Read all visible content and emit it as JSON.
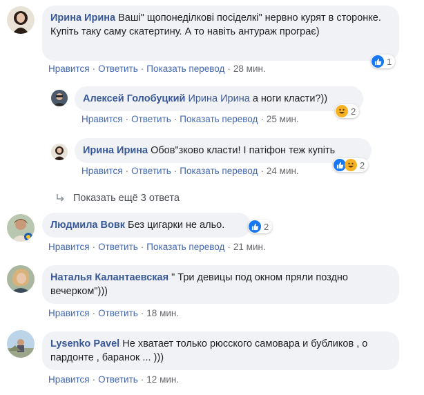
{
  "comments": [
    {
      "author": "Ирина Ирина",
      "text": "Ваші\" щопонеділкові посіделкі\" нервно курят в сторонке. Купіть таку саму скатертину. А то навіть антураж програє)",
      "actions": {
        "like": "Нравится",
        "reply": "Ответить",
        "translate": "Показать перевод",
        "time": "28 мин."
      },
      "reactions": {
        "count": "1",
        "icons": [
          "like-icon"
        ]
      }
    },
    {
      "author": "Алексей Голобуцкий",
      "mention": "Ирина Ирина",
      "text": "а ноги класти?))",
      "actions": {
        "like": "Нравится",
        "reply": "Ответить",
        "translate": "Показать перевод",
        "time": "25 мин."
      },
      "reactions": {
        "count": "2",
        "icons": [
          "haha-icon"
        ]
      }
    },
    {
      "author": "Ирина Ирина",
      "text": "Обов\"зково класти! І патіфон теж купіть",
      "actions": {
        "like": "Нравится",
        "reply": "Ответить",
        "translate": "Показать перевод",
        "time": "24 мин."
      },
      "reactions": {
        "count": "2",
        "icons": [
          "like-icon",
          "haha-icon"
        ]
      }
    },
    {
      "author": "Людмила Вовк",
      "text": "Без цигарки не альо.",
      "actions": {
        "like": "Нравится",
        "reply": "Ответить",
        "translate": "Показать перевод",
        "time": "21 мин."
      },
      "reactions": {
        "count": "2",
        "icons": [
          "like-icon"
        ]
      }
    },
    {
      "author": "Наталья Калантаевская",
      "text": "\" Три девицы под окном пряли поздно вечерком\")))",
      "actions": {
        "like": "Нравится",
        "reply": "Ответить",
        "time": "18 мин."
      }
    },
    {
      "author": "Lysenko Pavel",
      "text": "Не хватает только рюсского самовара и бубликов , о пардонте , баранок ... )))",
      "actions": {
        "like": "Нравится",
        "reply": "Ответить",
        "time": "12 мин."
      }
    }
  ],
  "more_replies": "Показать ещё 3 ответа",
  "colors": {
    "link": "#385898",
    "bubble": "#f0f2f5",
    "like": "#1877f2",
    "haha": "#f7b125",
    "muted": "#65676b"
  }
}
